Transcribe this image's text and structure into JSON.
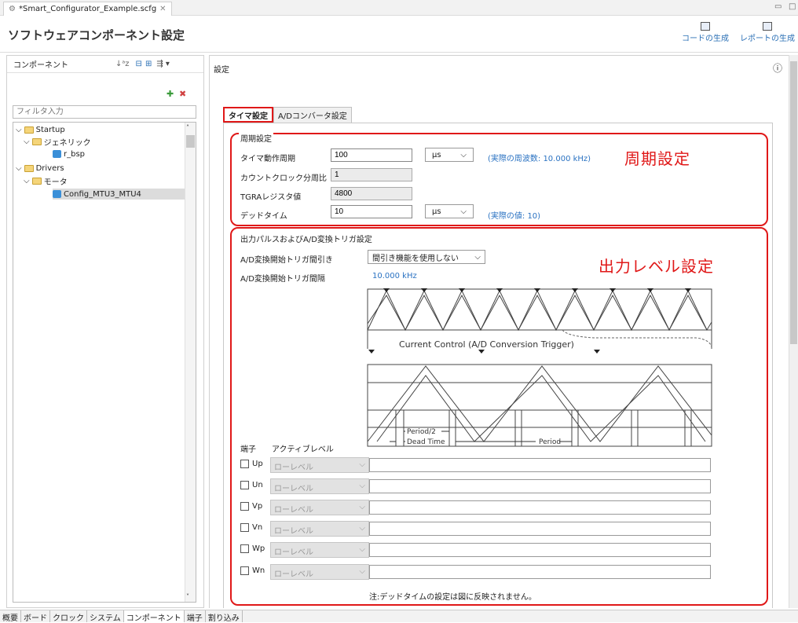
{
  "editor": {
    "file_tab": "*Smart_Configurator_Example.scfg",
    "title": "ソフトウェアコンポーネント設定",
    "btn_code": "コードの生成",
    "btn_report": "レポートの生成"
  },
  "left": {
    "header": "コンポーネント",
    "filter_placeholder": "フィルタ入力",
    "tree": {
      "startup": "Startup",
      "generic": "ジェネリック",
      "r_bsp": "r_bsp",
      "drivers": "Drivers",
      "motor": "モータ",
      "config": "Config_MTU3_MTU4"
    }
  },
  "right": {
    "header": "設定",
    "tab1": "タイマ設定",
    "tab2": "A/Dコンバータ設定"
  },
  "period": {
    "group": "周期設定",
    "timer_period_label": "タイマ動作周期",
    "timer_period_value": "100",
    "timer_period_unit": "μs",
    "actual_freq": "(実際の周波数: 10.000 kHz)",
    "clock_div_label": "カウントクロック分周比",
    "clock_div_value": "1",
    "tgra_label": "TGRAレジスタ値",
    "tgra_value": "4800",
    "dead_label": "デッドタイム",
    "dead_value": "10",
    "dead_unit": "μs",
    "actual_dead": "(実際の値: 10)",
    "annotation": "周期設定"
  },
  "output": {
    "group": "出力パルスおよびA/D変換トリガ設定",
    "skip_label": "A/D変換開始トリガ間引き",
    "skip_value": "間引き機能を使用しない",
    "interval_label": "A/D変換開始トリガ間隔",
    "interval_value": "10.000 kHz",
    "annotation": "出力レベル設定",
    "diagram": {
      "current_control": "Current Control (A/D Conversion Trigger)",
      "half_period": "Period/2",
      "dead_time": "Dead Time",
      "period": "Period"
    },
    "pin_header": "端子",
    "level_header": "アクティブレベル",
    "pins": [
      {
        "name": "Up",
        "level": "ローレベル"
      },
      {
        "name": "Un",
        "level": "ローレベル"
      },
      {
        "name": "Vp",
        "level": "ローレベル"
      },
      {
        "name": "Vn",
        "level": "ローレベル"
      },
      {
        "name": "Wp",
        "level": "ローレベル"
      },
      {
        "name": "Wn",
        "level": "ローレベル"
      }
    ],
    "note": "注:デッドタイムの設定は図に反映されません。"
  },
  "bottom_tabs": [
    "概要",
    "ボード",
    "クロック",
    "システム",
    "コンポーネント",
    "端子",
    "割り込み"
  ]
}
